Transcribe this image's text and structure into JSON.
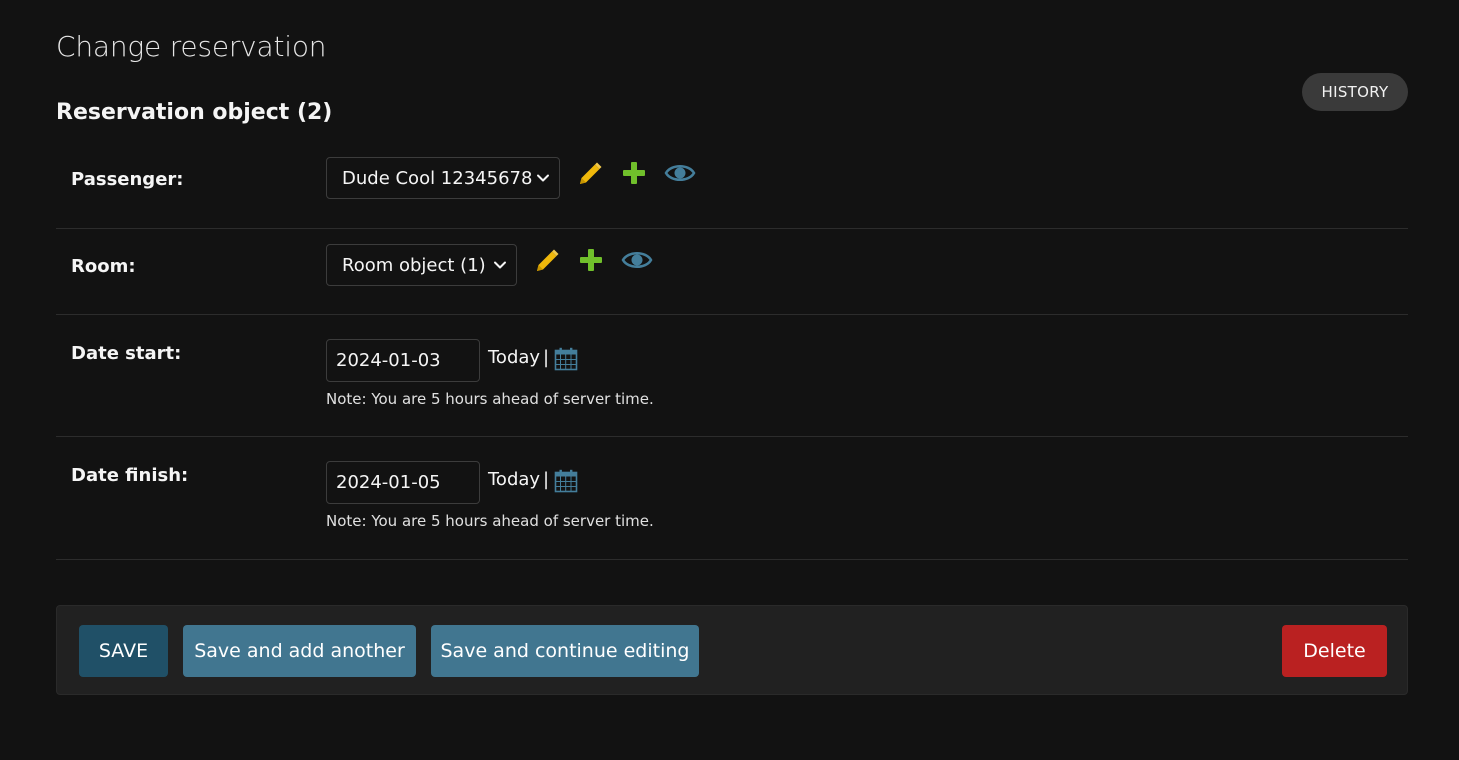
{
  "page": {
    "title": "Change reservation",
    "object_title": "Reservation object (2)",
    "history_label": "HISTORY"
  },
  "fields": {
    "passenger": {
      "label": "Passenger:",
      "selected": "Dude Cool 12345678"
    },
    "room": {
      "label": "Room:",
      "selected": "Room object (1)"
    },
    "date_start": {
      "label": "Date start:",
      "value": "2024-01-03",
      "today_label": "Today",
      "separator": "|",
      "note": "Note: You are 5 hours ahead of server time."
    },
    "date_finish": {
      "label": "Date finish:",
      "value": "2024-01-05",
      "today_label": "Today",
      "separator": "|",
      "note": "Note: You are 5 hours ahead of server time."
    }
  },
  "actions": {
    "save": "SAVE",
    "save_add": "Save and add another",
    "save_continue": "Save and continue editing",
    "delete": "Delete"
  },
  "icons": {
    "change": "pencil-icon",
    "add": "plus-icon",
    "view": "eye-icon",
    "calendar": "calendar-icon",
    "dropdown": "chevron-down-icon"
  },
  "colors": {
    "background": "#121212",
    "pencil": "#efb80b",
    "plus": "#70bf2b",
    "eye": "#447e9b",
    "calendar": "#447e9b",
    "save_button": "#205067",
    "secondary_button": "#417690",
    "delete_button": "#ba2121"
  }
}
